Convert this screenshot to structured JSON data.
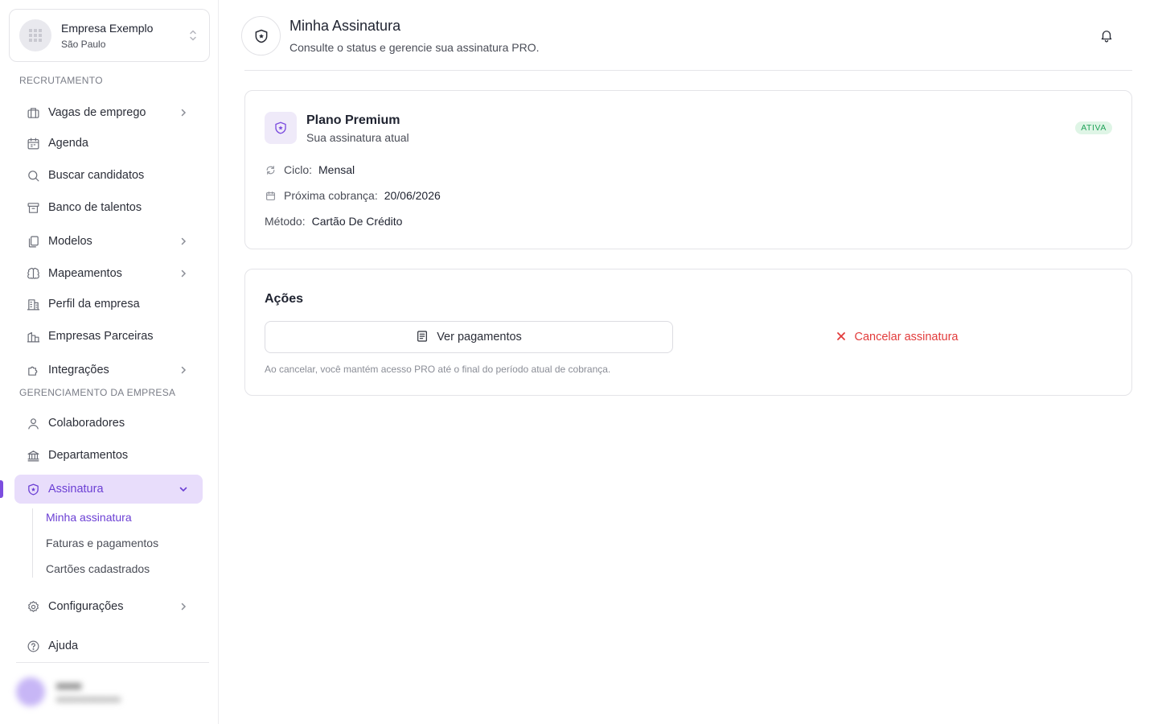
{
  "company": {
    "name": "Empresa Exemplo",
    "city": "São Paulo"
  },
  "sidebar": {
    "section_recruitment": "RECRUTAMENTO",
    "section_management": "GERENCIAMENTO DA EMPRESA",
    "items": [
      {
        "label": "Vagas de emprego",
        "icon": "briefcase-icon"
      },
      {
        "label": "Agenda",
        "icon": "calendar-icon"
      },
      {
        "label": "Buscar candidatos",
        "icon": "search-icon"
      },
      {
        "label": "Banco de talentos",
        "icon": "archive-icon"
      },
      {
        "label": "Modelos",
        "icon": "copy-icon"
      },
      {
        "label": "Mapeamentos",
        "icon": "brain-icon"
      },
      {
        "label": "Perfil da empresa",
        "icon": "building-icon"
      },
      {
        "label": "Empresas Parceiras",
        "icon": "buildings-icon"
      },
      {
        "label": "Integrações",
        "icon": "puzzle-icon"
      },
      {
        "label": "Colaboradores",
        "icon": "user-icon"
      },
      {
        "label": "Departamentos",
        "icon": "landmark-icon"
      },
      {
        "label": "Assinatura",
        "icon": "shield-icon"
      },
      {
        "label": "Configurações",
        "icon": "gear-icon"
      },
      {
        "label": "Ajuda",
        "icon": "help-icon"
      }
    ],
    "subscription_subitems": [
      {
        "label": "Minha assinatura"
      },
      {
        "label": "Faturas e pagamentos"
      },
      {
        "label": "Cartões cadastrados"
      }
    ]
  },
  "header": {
    "title": "Minha Assinatura",
    "subtitle": "Consulte o status e gerencie sua assinatura PRO."
  },
  "plan": {
    "name": "Plano Premium",
    "subtitle": "Sua assinatura atual",
    "status": "ATIVA",
    "cycle_label": "Ciclo:",
    "cycle_value": "Mensal",
    "next_charge_label": "Próxima cobrança:",
    "next_charge_value": "20/06/2026",
    "method_label": "Método:",
    "method_value": "Cartão De Crédito"
  },
  "actions": {
    "title": "Ações",
    "view_payments": "Ver pagamentos",
    "cancel": "Cancelar assinatura",
    "note": "Ao cancelar, você mantém acesso PRO até o final do período atual de cobrança."
  },
  "colors": {
    "accent": "#7c4ddf",
    "active_bg": "#e8ddfb",
    "success": "#22a35a",
    "danger": "#e23b3b"
  }
}
